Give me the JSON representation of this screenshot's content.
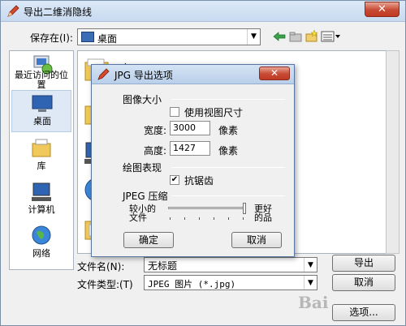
{
  "window": {
    "title": "导出二维消隐线",
    "close_glyph": "✕"
  },
  "savein": {
    "label": "保存在(I):",
    "value": "桌面"
  },
  "toolbar": [
    "back-arrow-icon",
    "up-folder-icon",
    "new-folder-icon",
    "view-menu-icon"
  ],
  "places": [
    {
      "label": "最近访问的位置"
    },
    {
      "label": "桌面"
    },
    {
      "label": "库"
    },
    {
      "label": "计算机"
    },
    {
      "label": "网络"
    }
  ],
  "filelist": {
    "first_item": "库"
  },
  "filename": {
    "label": "文件名(N):",
    "value": "无标题"
  },
  "filetype": {
    "label": "文件类型:(T)",
    "value": "JPEG 图片 (*.jpg)"
  },
  "buttons": {
    "export": "导出",
    "cancel": "取消",
    "options": "选项..."
  },
  "watermark": "Bai",
  "jpg_dialog": {
    "title": "JPG 导出选项",
    "close_glyph": "✕",
    "image_size": {
      "heading": "图像大小",
      "use_view_size": {
        "label": "使用视图尺寸",
        "checked": false
      },
      "width": {
        "label": "宽度:",
        "value": "3000",
        "unit": "像素"
      },
      "height": {
        "label": "高度:",
        "value": "1427",
        "unit": "像素"
      }
    },
    "render": {
      "heading": "绘图表现",
      "antialias": {
        "label": "抗锯齿",
        "checked": true,
        "mark": "✔"
      }
    },
    "jpeg": {
      "heading": "JPEG 压缩",
      "left_label_1": "较小的",
      "left_label_2": "文件",
      "right_label_1": "更好",
      "right_label_2": "的品",
      "quality_level": 1.0
    },
    "ok": "确定",
    "cancel": "取消"
  }
}
